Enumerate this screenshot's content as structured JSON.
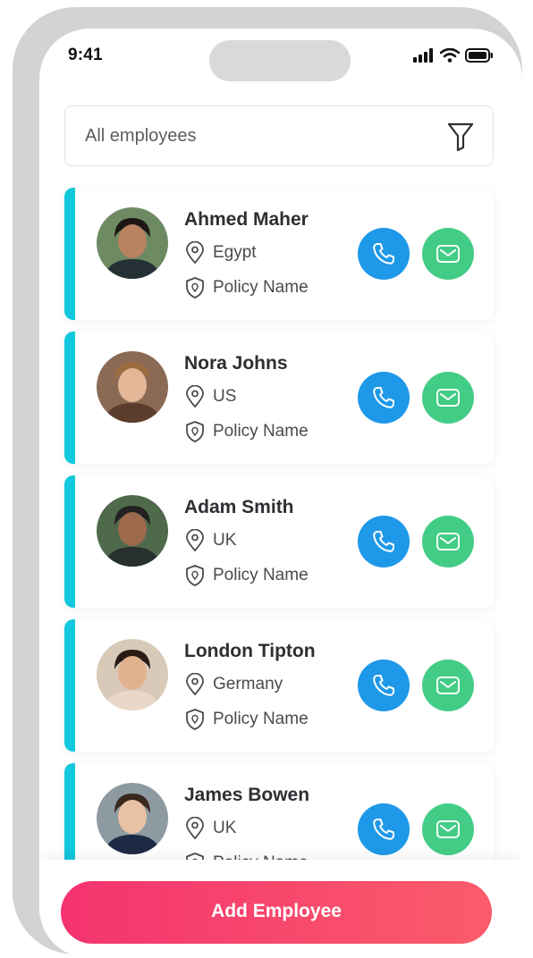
{
  "status_bar": {
    "time": "9:41"
  },
  "search": {
    "label": "All employees"
  },
  "employees": [
    {
      "name": "Ahmed Maher",
      "location": "Egypt",
      "policy": "Policy Name",
      "skin": "#b98261",
      "hair": "#1d1713",
      "shirt": "#243034"
    },
    {
      "name": "Nora Johns",
      "location": "US",
      "policy": "Policy Name",
      "skin": "#e4b798",
      "hair": "#9c6a3f",
      "shirt": "#5c3c2c"
    },
    {
      "name": "Adam Smith",
      "location": "UK",
      "policy": "Policy Name",
      "skin": "#9d6a4d",
      "hair": "#232021",
      "shirt": "#27302e"
    },
    {
      "name": "London Tipton",
      "location": "Germany",
      "policy": "Policy Name",
      "skin": "#e2b28f",
      "hair": "#2a1c14",
      "shirt": "#e9d8c8"
    },
    {
      "name": "James Bowen",
      "location": "UK",
      "policy": "Policy Name",
      "skin": "#e9c2a4",
      "hair": "#3a281e",
      "shirt": "#1f2a44"
    }
  ],
  "footer": {
    "add_label": "Add Employee"
  },
  "colors": {
    "accent": "#12c8dc",
    "call": "#1e98e8",
    "mail": "#43cc85",
    "cta_start": "#f4336f",
    "cta_end": "#fb5c6a"
  }
}
